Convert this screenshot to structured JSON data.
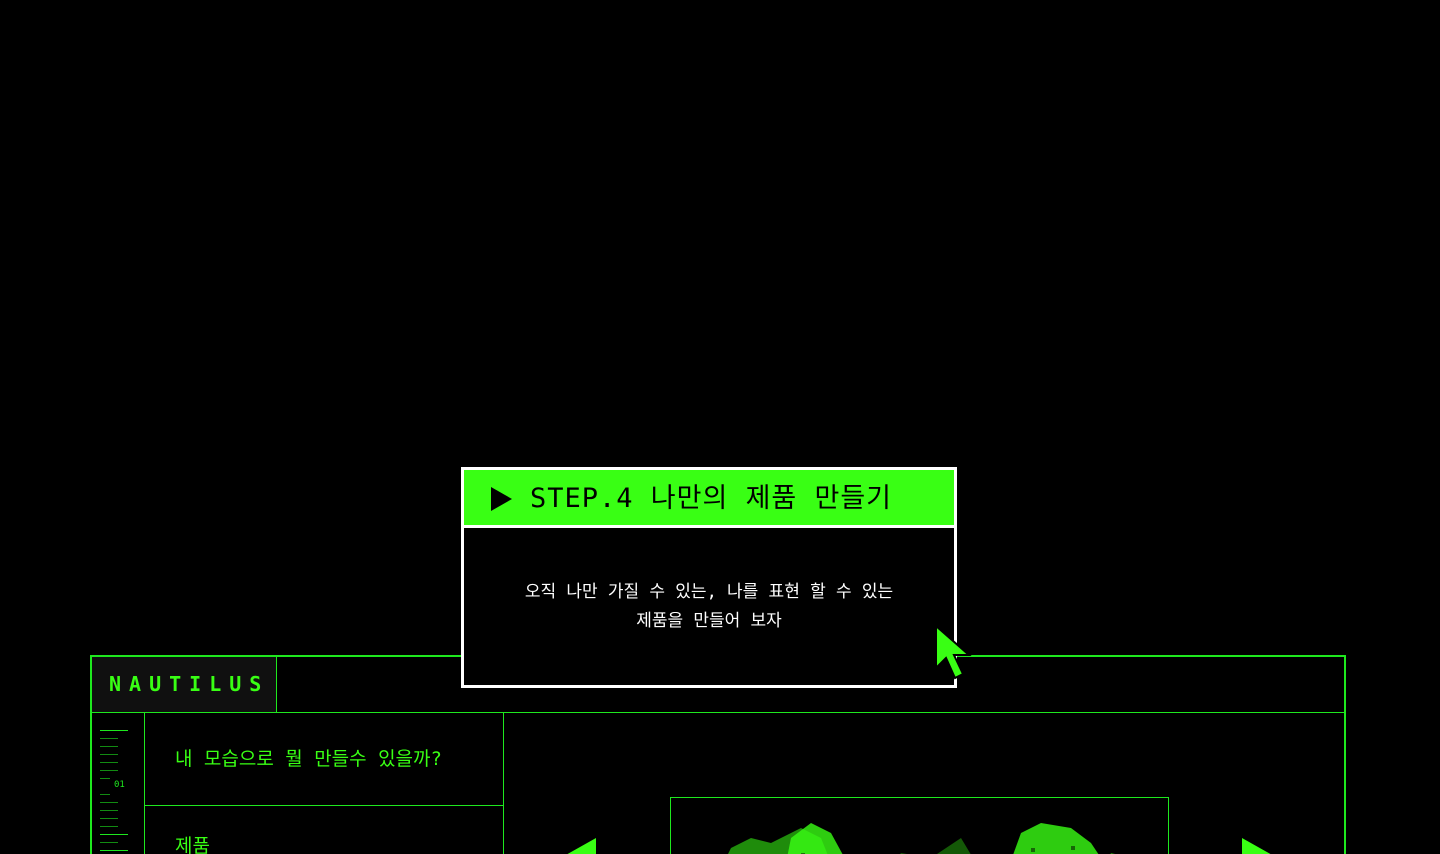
{
  "app": {
    "brand": "NAUTILUS",
    "ruler_label": "01",
    "questions": [
      {
        "label": "내 모습으로 뭘 만들수 있을까?"
      },
      {
        "label": "제품"
      }
    ]
  },
  "modal": {
    "title": "STEP.4 나만의 제품 만들기",
    "body_line1": "오직 나만 가질 수 있는, 나를 표현 할 수 있는",
    "body_line2": "제품을 만들어 보자"
  },
  "colors": {
    "background": "#000000",
    "accent": "#39ff14",
    "line": "#1ee81e",
    "modal_border": "#ffffff"
  },
  "icons": {
    "play": "play-icon",
    "cursor": "pixel-arrow-cursor-icon",
    "prev": "arrow-left-icon",
    "next": "arrow-right-icon"
  }
}
